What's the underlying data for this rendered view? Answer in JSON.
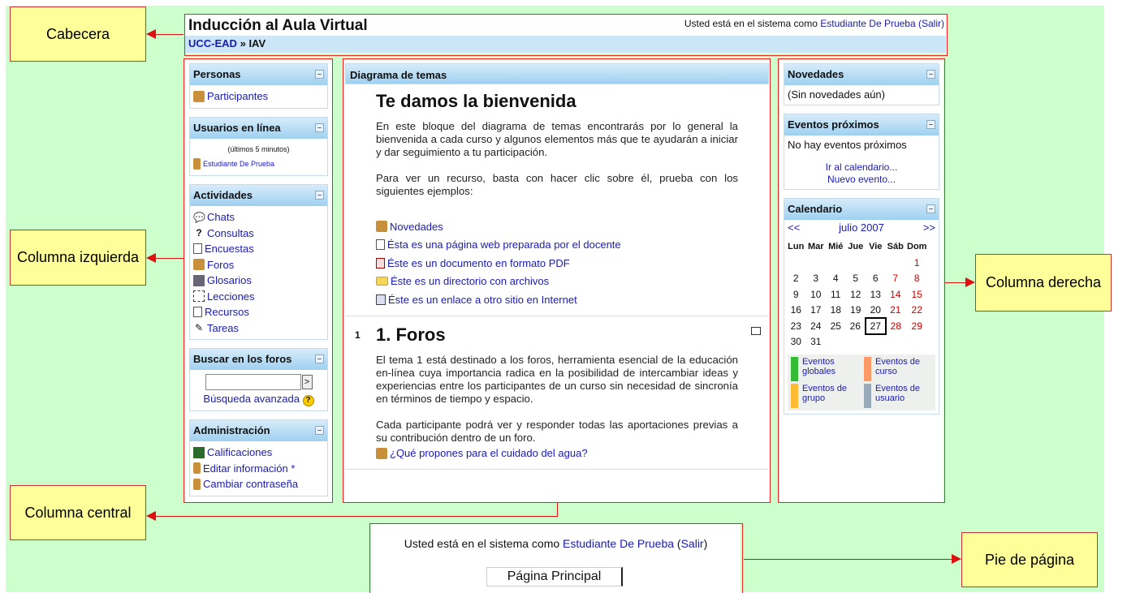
{
  "callouts": {
    "header": "Cabecera",
    "left": "Columna izquierda",
    "center": "Columna central",
    "right": "Columna derecha",
    "footer": "Pie de página"
  },
  "header": {
    "title": "Inducción al Aula Virtual",
    "login_prefix": "Usted está en el sistema como",
    "user": "Estudiante De Prueba",
    "logout": "(Salir)",
    "breadcrumb_home": "UCC-EAD",
    "breadcrumb_sep": "»",
    "breadcrumb_course": "IAV"
  },
  "left": {
    "personas": {
      "title": "Personas",
      "participants": "Participantes"
    },
    "online": {
      "title": "Usuarios en línea",
      "note": "(últimos 5 minutos)",
      "user": "Estudiante De Prueba"
    },
    "activities": {
      "title": "Actividades",
      "items": [
        "Chats",
        "Consultas",
        "Encuestas",
        "Foros",
        "Glosarios",
        "Lecciones",
        "Recursos",
        "Tareas"
      ]
    },
    "search": {
      "title": "Buscar en los foros",
      "go": ">",
      "advanced": "Búsqueda avanzada",
      "help": "?"
    },
    "admin": {
      "title": "Administración",
      "items": [
        "Calificaciones",
        "Editar información *",
        "Cambiar contraseña"
      ]
    },
    "toggle": "–"
  },
  "center": {
    "title": "Diagrama de temas",
    "welcome": {
      "heading": "Te damos la bienvenida",
      "p1": "En este bloque del diagrama de temas encontrarás por lo general la bienvenida a cada curso y algunos elementos más que te ayudarán a iniciar y dar seguimiento a tu participación.",
      "p2": "Para ver un recurso, basta con hacer clic sobre él, prueba con los siguientes ejemplos:",
      "resources": [
        "Novedades",
        "Ésta es una página web preparada por el docente",
        "Éste es un documento en formato PDF",
        "Éste es un directorio con archivos",
        "Éste es un enlace a otro sitio en Internet"
      ]
    },
    "topic1": {
      "number": "1",
      "heading": "1. Foros",
      "p1": "El tema 1 está destinado a los foros, herramienta esencial de la educación en-línea cuya importancia radica en la posibilidad de intercambiar ideas y experiencias entre los participantes de un curso sin necesidad de sincronía en términos de tiempo y espacio.",
      "p2": "Cada participante podrá ver y responder todas las aportaciones previas a su contribución dentro de un foro.",
      "forum": "¿Qué propones para el cuidado del agua?"
    }
  },
  "right": {
    "news": {
      "title": "Novedades",
      "body": "(Sin novedades aún)"
    },
    "events": {
      "title": "Eventos próximos",
      "body": "No hay eventos próximos",
      "calendar_link": "Ir al calendario...",
      "new_event": "Nuevo evento..."
    },
    "calendar": {
      "title": "Calendario",
      "prev": "<<",
      "month": "julio 2007",
      "next": ">>",
      "days": [
        "Lun",
        "Mar",
        "Mié",
        "Jue",
        "Vie",
        "Sáb",
        "Dom"
      ],
      "weeks": [
        [
          "",
          "",
          "",
          "",
          "",
          "",
          "1"
        ],
        [
          "2",
          "3",
          "4",
          "5",
          "6",
          "7",
          "8"
        ],
        [
          "9",
          "10",
          "11",
          "12",
          "13",
          "14",
          "15"
        ],
        [
          "16",
          "17",
          "18",
          "19",
          "20",
          "21",
          "22"
        ],
        [
          "23",
          "24",
          "25",
          "26",
          "27",
          "28",
          "29"
        ],
        [
          "30",
          "31",
          "",
          "",
          "",
          "",
          ""
        ]
      ],
      "today": "27",
      "legend": [
        {
          "label": "Eventos globales",
          "color": "#33bb33"
        },
        {
          "label": "Eventos de curso",
          "color": "#ff9966"
        },
        {
          "label": "Eventos de grupo",
          "color": "#ffbb33"
        },
        {
          "label": "Eventos de usuario",
          "color": "#99aabb"
        }
      ]
    }
  },
  "footer": {
    "login_prefix": "Usted está en el sistema como",
    "user": "Estudiante De Prueba",
    "logout": "Salir",
    "home": "Página Principal"
  },
  "colors": {
    "background": "#ccffcc",
    "callout": "#ffff99",
    "annotation": "#dd1111",
    "link": "#1a1ab5"
  }
}
